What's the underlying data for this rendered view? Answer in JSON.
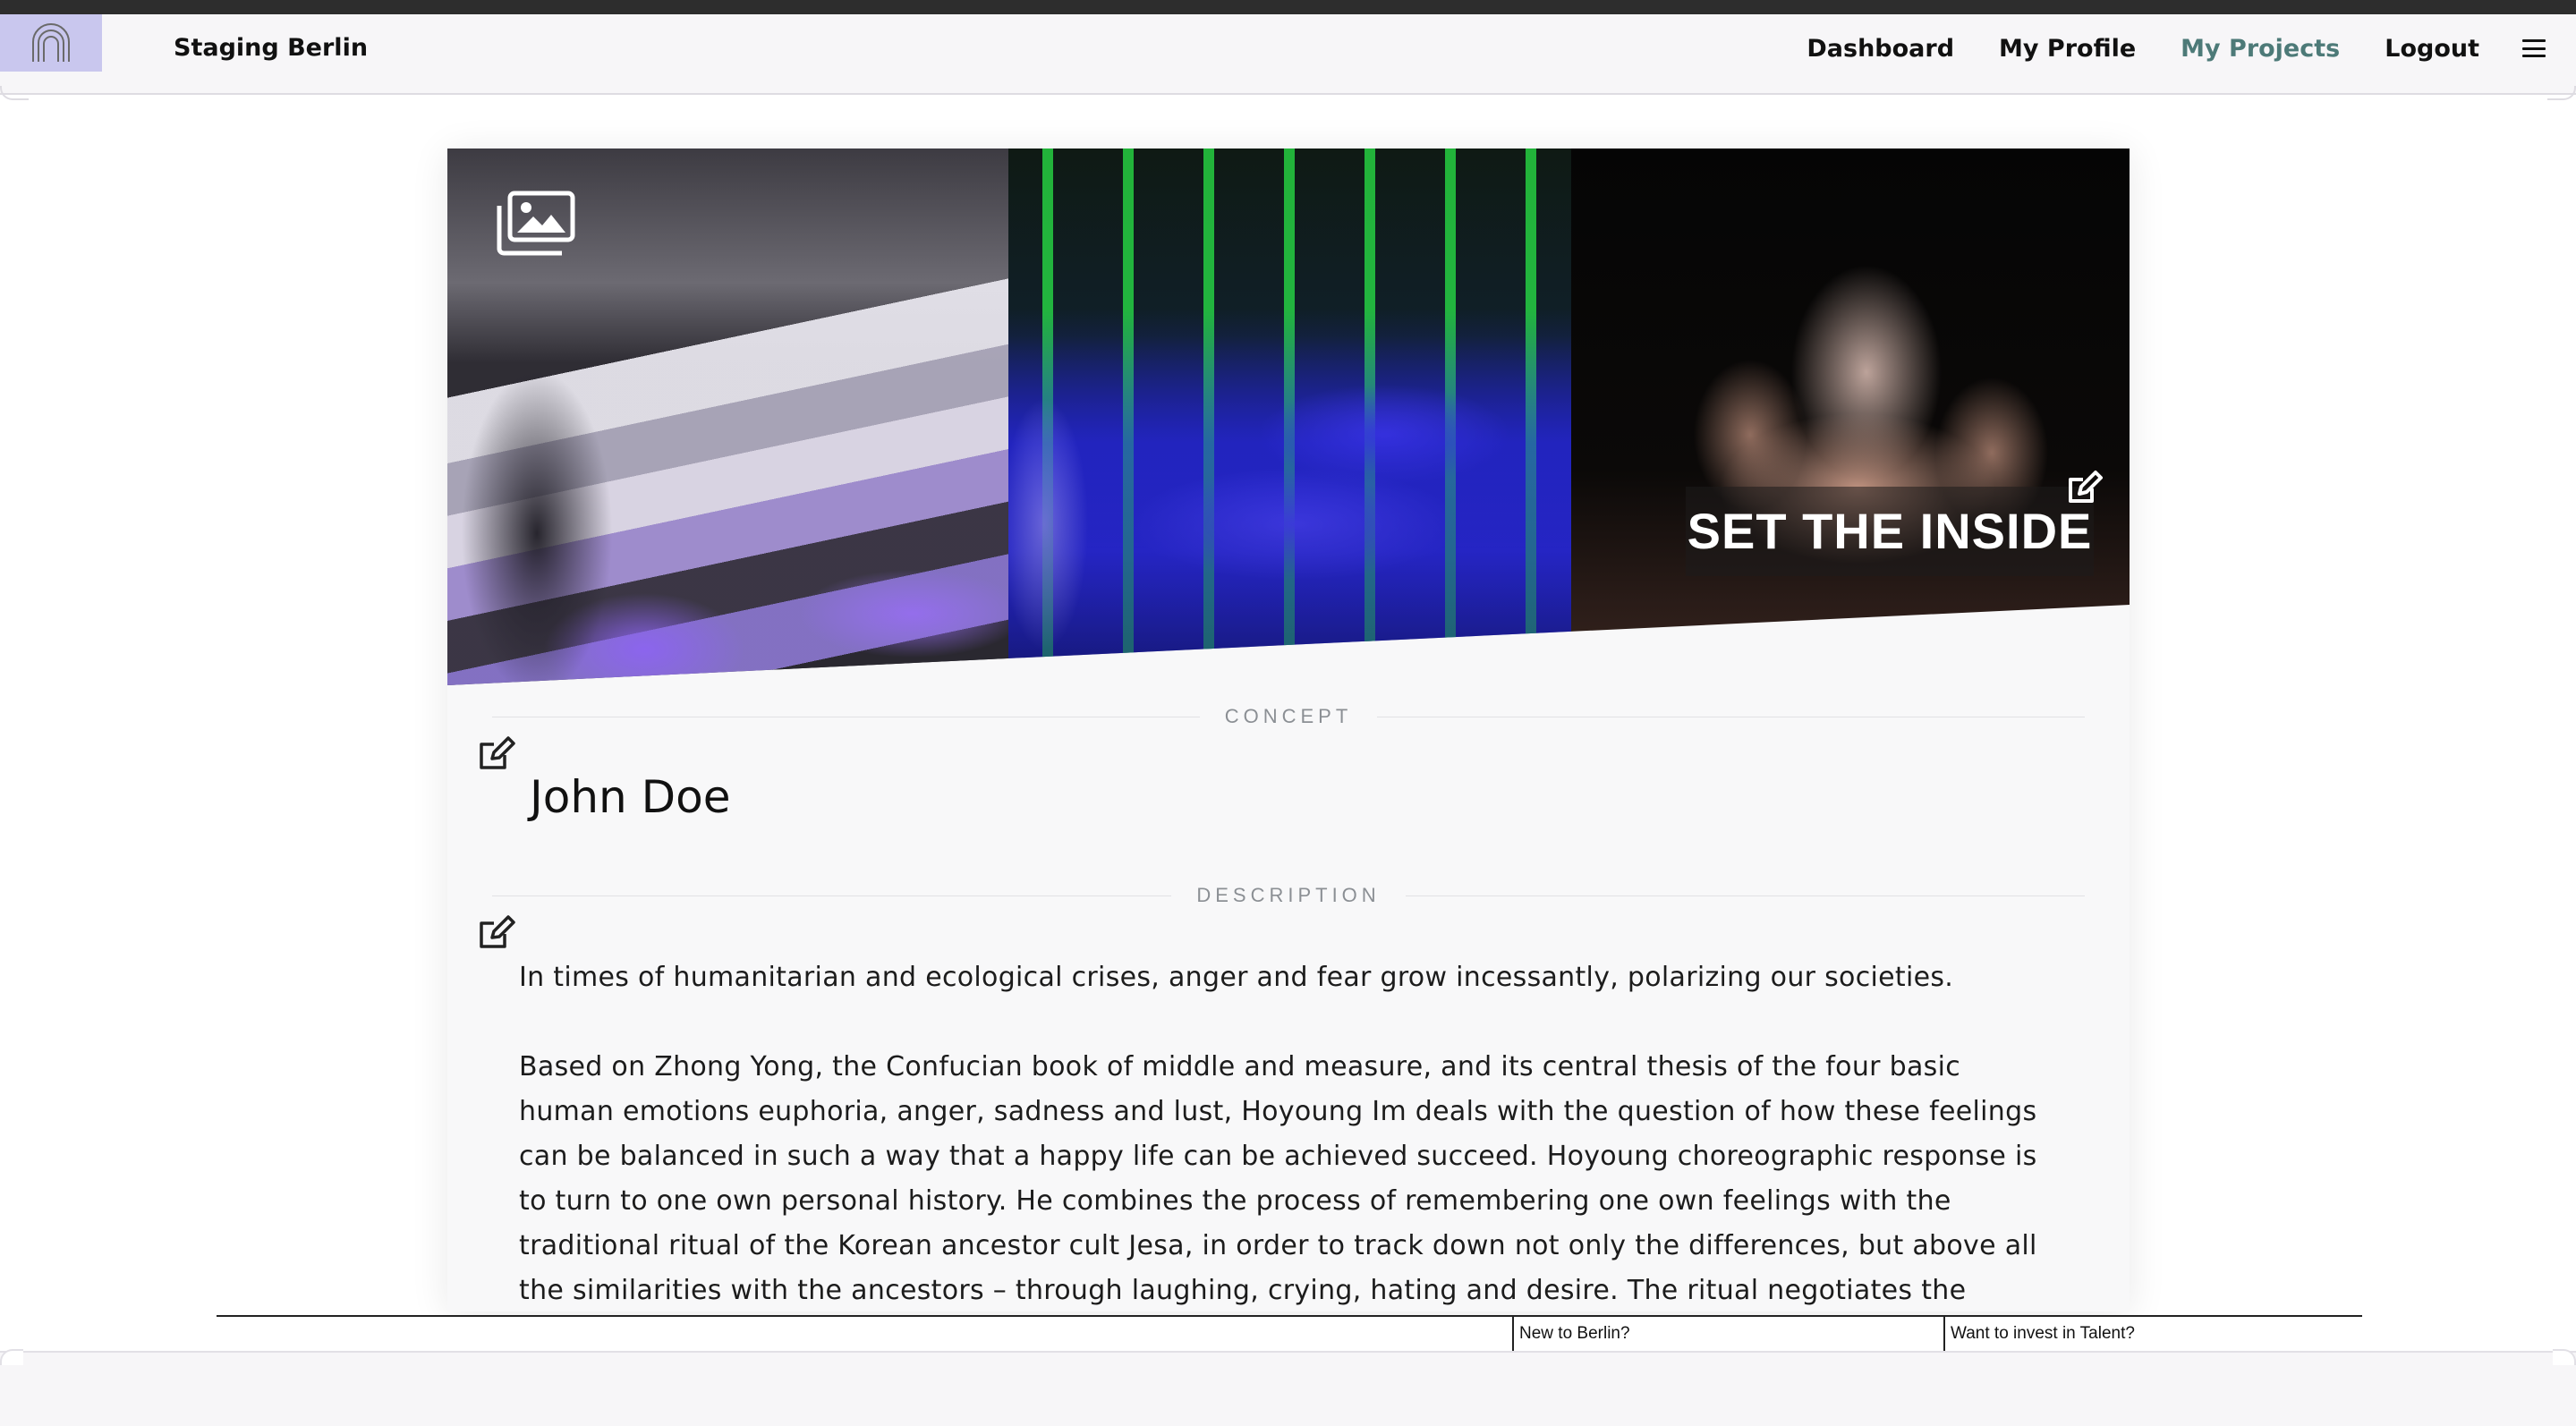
{
  "navbar": {
    "brand": "Staging Berlin",
    "links": [
      "Dashboard",
      "My Profile",
      "My Projects",
      "Logout"
    ],
    "active_link": "My Projects",
    "active_color": "#4d7a78"
  },
  "hero": {
    "title": "SET THE INSIDE",
    "icons": [
      "gallery-icon",
      "edit-icon"
    ]
  },
  "concept": {
    "label": "CONCEPT",
    "title": "John Doe"
  },
  "description": {
    "label": "DESCRIPTION",
    "paragraphs": [
      "In times of humanitarian and ecological crises, anger and fear grow incessantly, polarizing our societies.",
      "Based on Zhong Yong, the Confucian book of middle and measure, and its central thesis of the four basic human emotions euphoria, anger, sadness and lust, Hoyoung Im deals with the question of how these feelings can be balanced in such a way that a happy life can be achieved succeed. Hoyoung choreographic response is to turn to one own personal history. He combines the process of remembering one own feelings with the traditional ritual of the Korean ancestor cult Jesa, in order to track down not only the differences, but above all the similarities with the ancestors – through laughing, crying, hating and desire. The ritual negotiates the question of an ideal harmonious"
    ]
  },
  "footer": {
    "links": [
      "New to Berlin?",
      "Want to invest in Talent?"
    ]
  }
}
